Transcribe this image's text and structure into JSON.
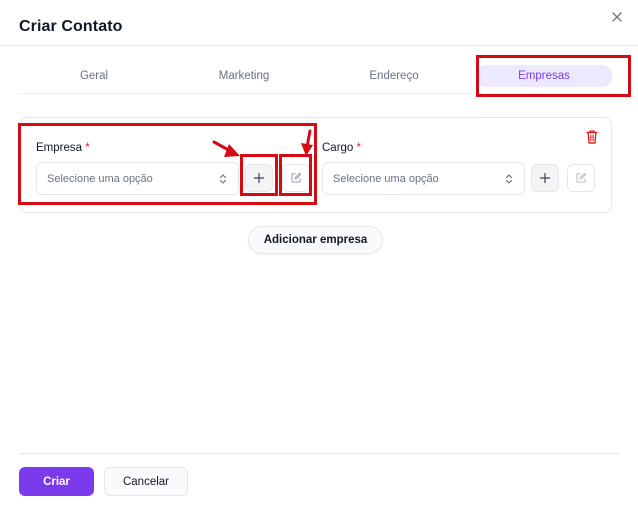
{
  "modal": {
    "title": "Criar Contato"
  },
  "tabs": [
    {
      "label": "Geral",
      "active": false
    },
    {
      "label": "Marketing",
      "active": false
    },
    {
      "label": "Endereço",
      "active": false
    },
    {
      "label": "Empresas",
      "active": true
    }
  ],
  "company_row": {
    "company": {
      "label": "Empresa",
      "required_mark": "*",
      "placeholder": "Selecione uma opção"
    },
    "role": {
      "label": "Cargo",
      "required_mark": "*",
      "placeholder": "Selecione uma opção"
    }
  },
  "actions": {
    "add_company": "Adicionar empresa",
    "create": "Criar",
    "cancel": "Cancelar"
  },
  "icons": {
    "close": "close-icon",
    "trash": "trash-icon",
    "plus": "plus-icon",
    "edit": "edit-icon",
    "chevron": "chevron-up-down-icon"
  },
  "colors": {
    "accent": "#7c3aed",
    "accent_soft": "#ede9fe",
    "danger": "#dc2626",
    "annotation": "#d40b14"
  }
}
